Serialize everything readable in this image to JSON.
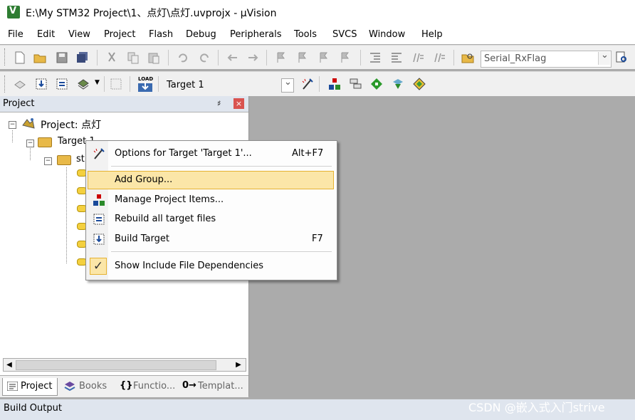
{
  "window": {
    "title": "E:\\My STM32 Project\\1、点灯\\点灯.uvprojx - µVision"
  },
  "menu": [
    "File",
    "Edit",
    "View",
    "Project",
    "Flash",
    "Debug",
    "Peripherals",
    "Tools",
    "SVCS",
    "Window",
    "Help"
  ],
  "toolbar1": {
    "find_combo_value": "Serial_RxFlag"
  },
  "toolbar2": {
    "target_combo_value": "Target 1",
    "load_label": "LOAD"
  },
  "project_panel": {
    "title": "Project",
    "pin": "♯",
    "close": "×",
    "tree": {
      "root": "Project: 点灯",
      "target": "Target 1",
      "group_partial": "st"
    }
  },
  "context_menu": {
    "items": [
      {
        "label": "Options for Target 'Target 1'...",
        "shortcut": "Alt+F7"
      },
      {
        "label": "Add Group...",
        "shortcut": ""
      },
      {
        "label": "Manage Project Items...",
        "shortcut": ""
      },
      {
        "label": "Rebuild all target files",
        "shortcut": ""
      },
      {
        "label": "Build Target",
        "shortcut": "F7"
      },
      {
        "label": "Show Include File Dependencies",
        "shortcut": "",
        "checked": true
      }
    ]
  },
  "panel_tabs": [
    {
      "label": "Project",
      "active": true
    },
    {
      "label": "Books",
      "active": false
    },
    {
      "label": "Functio...",
      "prefix": "{}",
      "active": false
    },
    {
      "label": "Templat...",
      "prefix": "0→",
      "active": false
    }
  ],
  "build_output": {
    "label": "Build Output"
  },
  "watermark": "CSDN @嵌入式入门strive",
  "colors": {
    "menu_highlight": "#fbe6a8",
    "menu_highlight_border": "#e5b232",
    "editor_bg": "#ababab",
    "panel_header": "#dfe5ee"
  }
}
